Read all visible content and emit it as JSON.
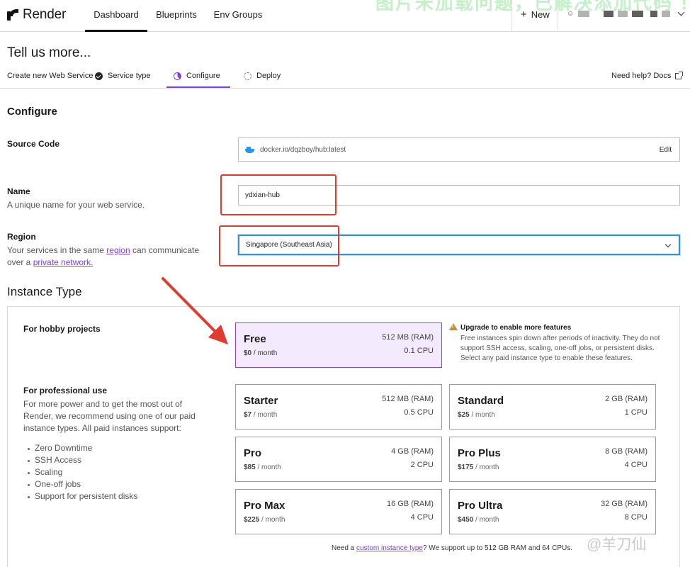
{
  "nav": {
    "logo_text": "Render",
    "tabs": [
      "Dashboard",
      "Blueprints",
      "Env Groups"
    ],
    "new_label": "New",
    "overlay_text": "图片未加载问题，已解决添加代码 ！"
  },
  "page": {
    "title": "Tell us more...",
    "create_label": "Create new Web Service",
    "steps": [
      "Service type",
      "Configure",
      "Deploy"
    ],
    "help_label": "Need help? Docs"
  },
  "configure": {
    "title": "Configure",
    "source": {
      "label": "Source Code",
      "value": "docker.io/dqzboy/hub:latest",
      "edit_label": "Edit"
    },
    "name": {
      "label": "Name",
      "help": "A unique name for your web service.",
      "value": "ydxian-hub"
    },
    "region": {
      "label": "Region",
      "help_pre": "Your services in the same ",
      "help_link1": "region",
      "help_mid": " can communicate over a ",
      "help_link2": "private network.",
      "value": "Singapore (Southeast Asia)"
    }
  },
  "instance": {
    "title": "Instance Type",
    "hobby_label": "For hobby projects",
    "pro_label": "For professional use",
    "pro_text": "For more power and to get the most out of Render, we recommend using one of our paid instance types. All paid instances support:",
    "features": [
      "Zero Downtime",
      "SSH Access",
      "Scaling",
      "One-off jobs",
      "Support for persistent disks"
    ],
    "upgrade_title": "Upgrade to enable more features",
    "upgrade_text": "Free instances spin down after periods of inactivity. They do not support SSH access, scaling, one-off jobs, or persistent disks. Select any paid instance type to enable these features.",
    "per_month": "/ month",
    "cards": {
      "free": {
        "name": "Free",
        "price": "$0",
        "ram": "512 MB (RAM)",
        "cpu": "0.1 CPU"
      },
      "starter": {
        "name": "Starter",
        "price": "$7",
        "ram": "512 MB (RAM)",
        "cpu": "0.5 CPU"
      },
      "standard": {
        "name": "Standard",
        "price": "$25",
        "ram": "2 GB (RAM)",
        "cpu": "1 CPU"
      },
      "pro": {
        "name": "Pro",
        "price": "$85",
        "ram": "4 GB (RAM)",
        "cpu": "2 CPU"
      },
      "proplus": {
        "name": "Pro Plus",
        "price": "$175",
        "ram": "8 GB (RAM)",
        "cpu": "4 CPU"
      },
      "promax": {
        "name": "Pro Max",
        "price": "$225",
        "ram": "16 GB (RAM)",
        "cpu": "4 CPU"
      },
      "proultra": {
        "name": "Pro Ultra",
        "price": "$450",
        "ram": "32 GB (RAM)",
        "cpu": "8 CPU"
      }
    },
    "footnote_pre": "Need a ",
    "footnote_link": "custom instance type",
    "footnote_post": "? We support up to 512 GB RAM and 64 CPUs."
  },
  "watermark": "@羊刀仙",
  "colors": {
    "accent": "#7b3fe4",
    "annotation": "#e23a2e",
    "focus": "#3d8fc9"
  }
}
